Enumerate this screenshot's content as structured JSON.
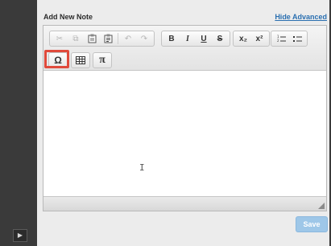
{
  "header": {
    "title": "Add New Note",
    "hide_advanced": "Hide Advanced"
  },
  "toolbar": {
    "row1": [
      {
        "icon": "cut-icon",
        "glyph": "✂",
        "enabled": false
      },
      {
        "icon": "copy-icon",
        "glyph": "⧉",
        "enabled": false
      },
      {
        "icon": "paste-icon",
        "glyph": "📋",
        "enabled": true
      },
      {
        "icon": "paste-text-icon",
        "glyph": "📋",
        "enabled": true
      },
      {
        "icon": "undo-icon",
        "glyph": "↶",
        "enabled": false
      },
      {
        "icon": "redo-icon",
        "glyph": "↷",
        "enabled": false
      },
      {
        "icon": "bold-icon",
        "glyph": "B",
        "enabled": true
      },
      {
        "icon": "italic-icon",
        "glyph": "I",
        "enabled": true
      },
      {
        "icon": "underline-icon",
        "glyph": "U",
        "enabled": true
      },
      {
        "icon": "strikethrough-icon",
        "glyph": "S",
        "enabled": true
      },
      {
        "icon": "subscript-icon",
        "glyph": "x₂",
        "enabled": true
      },
      {
        "icon": "superscript-icon",
        "glyph": "x²",
        "enabled": true
      },
      {
        "icon": "numbered-list-icon",
        "glyph": "⒈",
        "enabled": true
      },
      {
        "icon": "bullet-list-icon",
        "glyph": "≔",
        "enabled": true
      }
    ],
    "row2": [
      {
        "icon": "special-character-icon",
        "glyph": "Ω"
      },
      {
        "icon": "table-icon",
        "glyph": "▦"
      },
      {
        "icon": "math-icon",
        "glyph": "π"
      }
    ]
  },
  "footer": {
    "save_label": "Save"
  },
  "colors": {
    "accent": "#2a6fb0",
    "highlight": "#e04a3c",
    "save_disabled": "#9ec7e8"
  }
}
